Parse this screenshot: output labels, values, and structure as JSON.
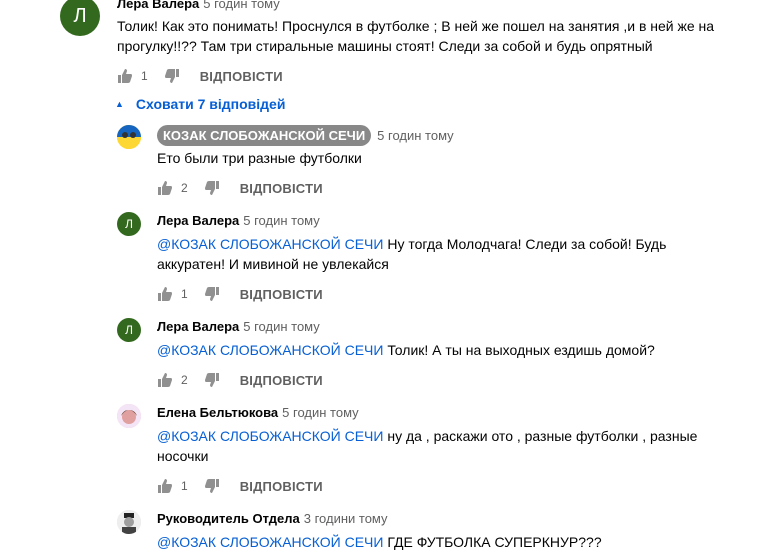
{
  "top_comment": {
    "avatar_letter": "Л",
    "author": "Лера Валера",
    "time": "5 годин тому",
    "text": "Толик! Как это понимать! Проснулся в футболке ; В ней же пошел на занятия ,и в ней же на прогулку!!?? Там три стиральные машины стоят! Следи за собой и будь опрятный",
    "likes": "1",
    "reply_label": "ВІДПОВІСТИ"
  },
  "hide_replies_label": "Сховати 7 відповідей",
  "replies": [
    {
      "author": "КОЗАК СЛОБОЖАНСКОЙ СЕЧИ",
      "time": "5 годин тому",
      "mention": "",
      "text": "Ето были три разные футболки",
      "likes": "2",
      "reply_label": "ВІДПОВІСТИ"
    },
    {
      "avatar_letter": "Л",
      "author": "Лера Валера",
      "time": "5 годин тому",
      "mention": "@КОЗАК СЛОБОЖАНСКОЙ СЕЧИ",
      "text": " Ну тогда Молодчага! Следи за собой! Будь аккуратен! И мивиной не увлекайся",
      "likes": "1",
      "reply_label": "ВІДПОВІСТИ"
    },
    {
      "avatar_letter": "Л",
      "author": "Лера Валера",
      "time": "5 годин тому",
      "mention": "@КОЗАК СЛОБОЖАНСКОЙ СЕЧИ",
      "text": " Толик! А ты на выходных ездишь домой?",
      "likes": "2",
      "reply_label": "ВІДПОВІСТИ"
    },
    {
      "author": "Елена Бельтюкова",
      "time": "5 годин тому",
      "mention": "@КОЗАК СЛОБОЖАНСКОЙ СЕЧИ",
      "text": " ну да , раскажи ото , разные футболки , разные носочки",
      "likes": "1",
      "reply_label": "ВІДПОВІСТИ"
    },
    {
      "author": "Руководитель Отдела",
      "time": "3 години тому",
      "mention": "@КОЗАК СЛОБОЖАНСКОЙ СЕЧИ",
      "text": " ГДЕ ФУТБОЛКА СУПЕРКНУР???"
    }
  ],
  "colors": {
    "link": "#065fd4",
    "meta": "#606060",
    "avatar_green": "#33691e",
    "pill_bg": "#888888"
  }
}
